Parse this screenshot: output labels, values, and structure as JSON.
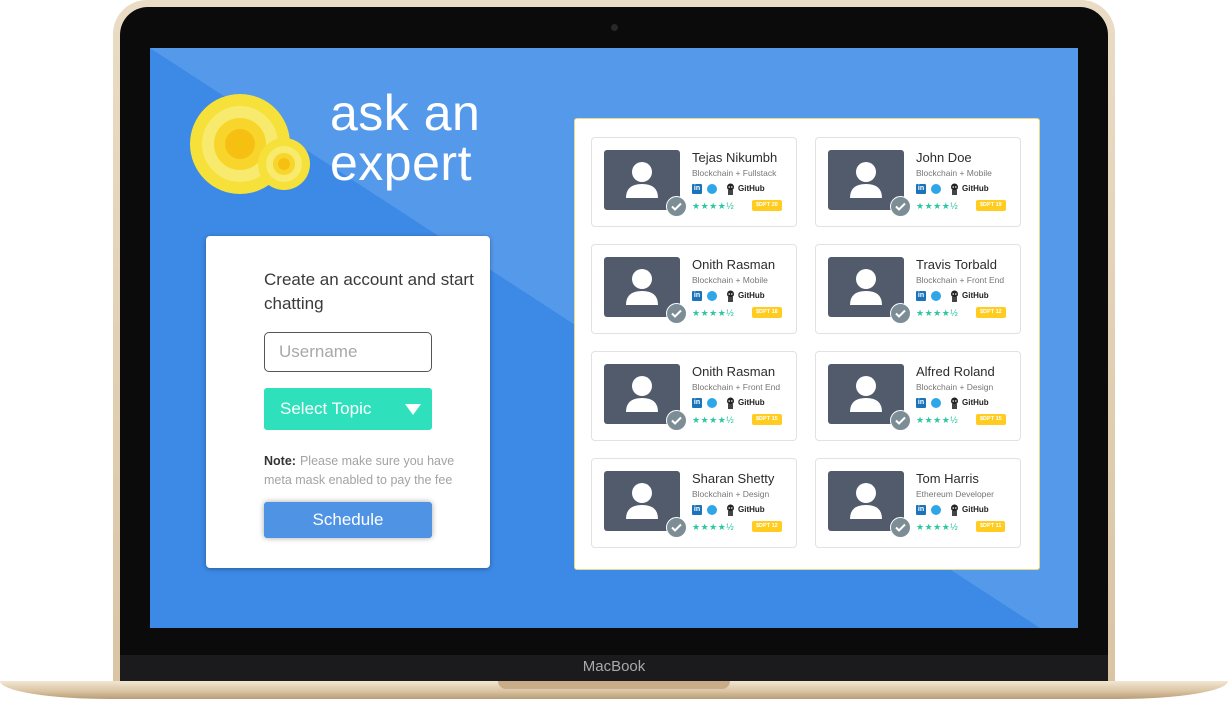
{
  "device": {
    "brand": "MacBook"
  },
  "app": {
    "logo_line1": "ask an",
    "logo_line2": "expert"
  },
  "signup": {
    "title": "Create an account and start chatting",
    "username_placeholder": "Username",
    "select_topic_label": "Select Topic",
    "note_label": "Note:",
    "note_text": "Please make sure you have meta mask enabled to pay the fee",
    "schedule_label": "Schedule"
  },
  "social": {
    "github_label": "GitHub"
  },
  "colors": {
    "accent_blue": "#3c8ae6",
    "topic_teal": "#2fe0bd",
    "price_yellow": "#ffcc1f",
    "star_teal": "#2bc7a3"
  },
  "experts": [
    {
      "name": "Tejas Nikumbh",
      "specialty": "Blockchain + Fullstack",
      "rating": "★★★★½",
      "price": "$DPT 20"
    },
    {
      "name": "John Doe",
      "specialty": "Blockchain + Mobile",
      "rating": "★★★★½",
      "price": "$DPT 19"
    },
    {
      "name": "Onith Rasman",
      "specialty": "Blockchain + Mobile",
      "rating": "★★★★½",
      "price": "$DPT 18"
    },
    {
      "name": "Travis Torbald",
      "specialty": "Blockchain + Front End",
      "rating": "★★★★½",
      "price": "$DPT 12"
    },
    {
      "name": "Onith Rasman",
      "specialty": "Blockchain + Front End",
      "rating": "★★★★½",
      "price": "$DPT 15"
    },
    {
      "name": "Alfred Roland",
      "specialty": "Blockchain + Design",
      "rating": "★★★★½",
      "price": "$DPT 15"
    },
    {
      "name": "Sharan Shetty",
      "specialty": "Blockchain + Design",
      "rating": "★★★★½",
      "price": "$DPT 12"
    },
    {
      "name": "Tom Harris",
      "specialty": "Ethereum Developer",
      "rating": "★★★★½",
      "price": "$DPT 11"
    }
  ]
}
